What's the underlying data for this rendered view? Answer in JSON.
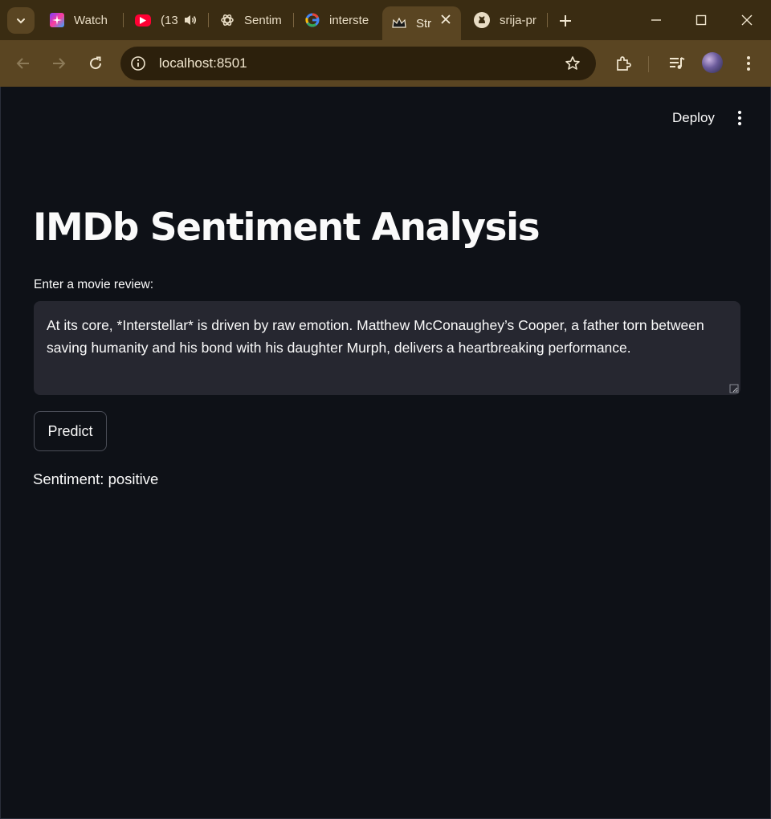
{
  "browser": {
    "tabs": [
      {
        "label": "Watch",
        "favicon": "sparkle-favicon-icon",
        "active": false
      },
      {
        "label": "(13",
        "favicon": "youtube-icon",
        "audio": "speaker-icon",
        "active": false
      },
      {
        "label": "Sentim",
        "favicon": "openai-icon",
        "active": false
      },
      {
        "label": "interste",
        "favicon": "google-icon",
        "active": false
      },
      {
        "label": "Str",
        "favicon": "streamlit-crown-icon",
        "active": true
      },
      {
        "label": "srija-pr",
        "favicon": "github-icon",
        "active": false
      }
    ],
    "url": "localhost:8501",
    "colors": {
      "frame": "#3a2c12",
      "toolbar": "#5a4522",
      "omnibox": "#2c200c"
    }
  },
  "app": {
    "deploy_label": "Deploy",
    "title": "IMDb Sentiment Analysis",
    "input_label": "Enter a movie review:",
    "review_text": "At its core, *Interstellar* is driven by raw emotion. Matthew McConaughey’s Cooper, a father torn between saving humanity and his bond with his daughter Murph, delivers a heartbreaking performance.",
    "predict_label": "Predict",
    "result_text": "Sentiment: positive",
    "colors": {
      "background": "#0e1117",
      "input_bg": "#262730",
      "text": "#fafafa"
    }
  }
}
